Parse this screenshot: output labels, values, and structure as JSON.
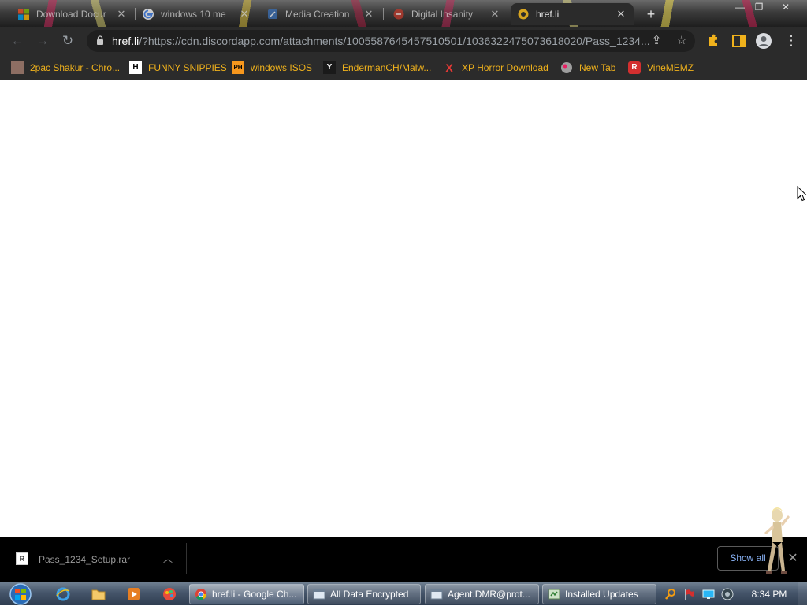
{
  "tabs": [
    {
      "title": "Download Docur",
      "icon": "microsoft-logo-icon"
    },
    {
      "title": "windows 10 me",
      "icon": "google-g-icon"
    },
    {
      "title": "Media Creation",
      "icon": "media-creation-icon"
    },
    {
      "title": "Digital Insanity",
      "icon": "digital-insanity-icon"
    },
    {
      "title": "href.li",
      "icon": "href-li-icon",
      "active": true
    }
  ],
  "toolbar": {
    "url_host": "href.li",
    "url_path": "/?https://cdn.discordapp.com/attachments/1005587645457510501/1036322475073618020/Pass_1234..."
  },
  "bookmarks": [
    {
      "label": "2pac Shakur - Chro...",
      "icon": "2pac-icon"
    },
    {
      "label": "FUNNY SNIPPIES",
      "icon": "h-logo-icon",
      "glyph": "H"
    },
    {
      "label": "windows ISOS",
      "icon": "ph-logo-icon",
      "glyph": "PH"
    },
    {
      "label": "EndermanCH/Malw...",
      "icon": "yp-logo-icon",
      "glyph": "Y"
    },
    {
      "label": "XP Horror Download",
      "icon": "x-logo-icon",
      "glyph": "X"
    },
    {
      "label": "New Tab",
      "icon": "globe-icon"
    },
    {
      "label": "VineMEMZ",
      "icon": "r-logo-icon",
      "glyph": "R"
    }
  ],
  "download": {
    "filename": "Pass_1234_Setup.rar",
    "show_all": "Show all"
  },
  "taskbar": {
    "items": [
      {
        "label": "href.li - Google Ch...",
        "icon": "chrome-icon",
        "active": true
      },
      {
        "label": "All Data Encrypted",
        "icon": "window-icon"
      },
      {
        "label": "Agent.DMR@prot...",
        "icon": "window-icon"
      },
      {
        "label": "Installed Updates",
        "icon": "control-panel-icon"
      }
    ],
    "clock": "8:34 PM"
  }
}
